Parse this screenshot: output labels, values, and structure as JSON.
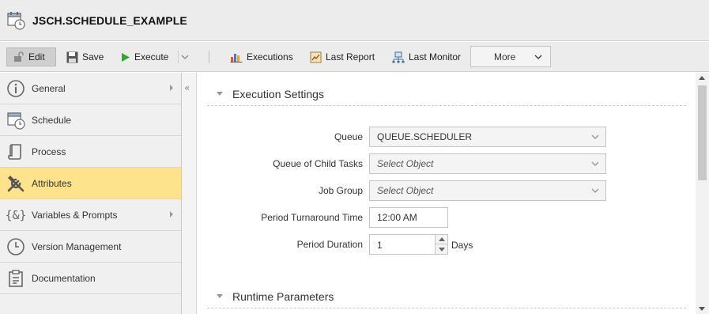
{
  "window": {
    "title": "JSCH.SCHEDULE_EXAMPLE",
    "icon": "schedule-calendar-icon"
  },
  "toolbar": {
    "edit": "Edit",
    "save": "Save",
    "execute": "Execute",
    "executions": "Executions",
    "last_report": "Last Report",
    "last_monitor": "Last Monitor",
    "more": "More"
  },
  "sidebar": {
    "items": [
      {
        "label": "General",
        "icon": "info-icon",
        "has_arrow": true
      },
      {
        "label": "Schedule",
        "icon": "schedule-calendar-icon",
        "has_arrow": false
      },
      {
        "label": "Process",
        "icon": "scroll-icon",
        "has_arrow": false
      },
      {
        "label": "Attributes",
        "icon": "tools-icon",
        "has_arrow": false,
        "active": true
      },
      {
        "label": "Variables & Prompts",
        "icon": "variables-braces-icon",
        "has_arrow": true
      },
      {
        "label": "Version Management",
        "icon": "clock-icon",
        "has_arrow": false
      },
      {
        "label": "Documentation",
        "icon": "clipboard-icon",
        "has_arrow": false
      }
    ]
  },
  "main": {
    "execution_settings": {
      "title": "Execution Settings",
      "queue": {
        "label": "Queue",
        "value": "QUEUE.SCHEDULER"
      },
      "child_queue": {
        "label": "Queue of Child Tasks",
        "placeholder": "Select Object"
      },
      "job_group": {
        "label": "Job Group",
        "placeholder": "Select Object"
      },
      "turnaround": {
        "label": "Period Turnaround Time",
        "value": "12:00 AM"
      },
      "duration": {
        "label": "Period Duration",
        "value": "1",
        "unit": "Days"
      }
    },
    "runtime_parameters": {
      "title": "Runtime Parameters"
    }
  },
  "colors": {
    "active_item": "#fde38b",
    "toolbar_bg": "#ececec",
    "accent_green": "#3aa335"
  }
}
